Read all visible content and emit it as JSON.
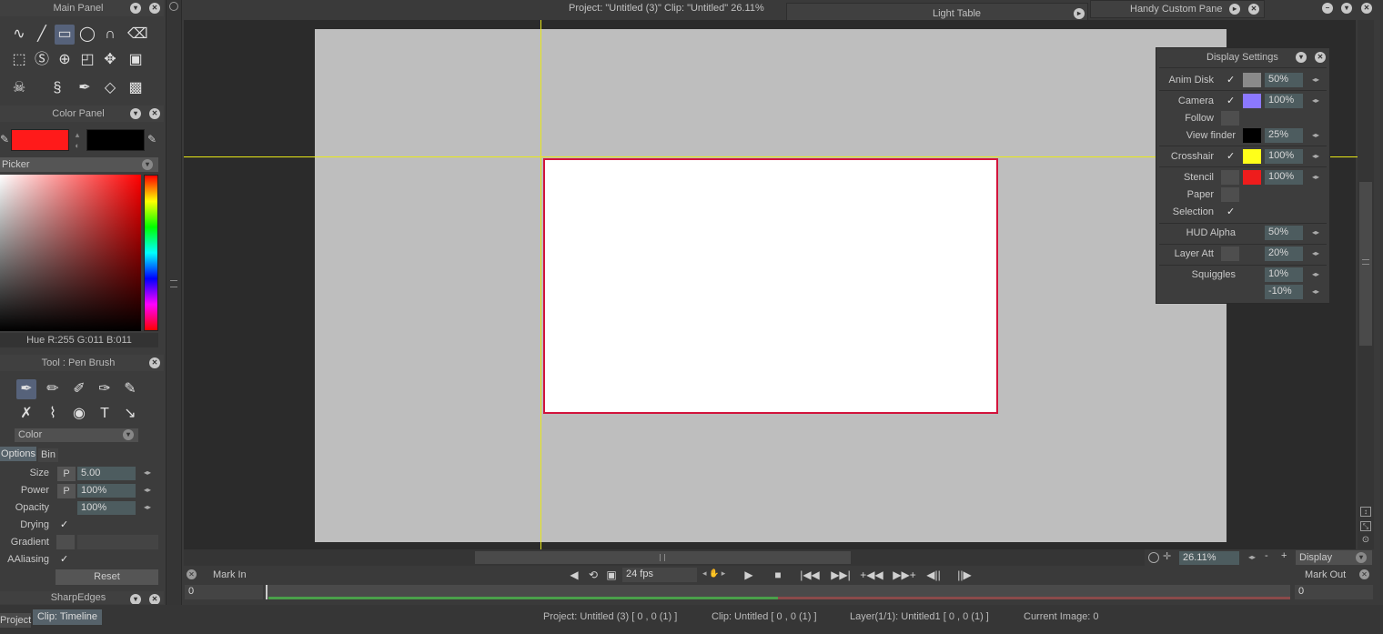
{
  "top_info": {
    "project_clip": "Project:  \"Untitled (3)\"  Clip: \"Untitled\"   26.11%",
    "light_table": "Light Table",
    "handy_custom": "Handy Custom Pane"
  },
  "main_panel": {
    "title": "Main Panel"
  },
  "color_panel": {
    "title": "Color Panel",
    "primary_color": "#ff1a1a",
    "secondary_color": "#000000",
    "picker_mode": "Picker",
    "readout": "Hue R:255 G:011 B:011"
  },
  "tool_panel": {
    "title": "Tool : Pen Brush",
    "color_dropdown": "Color",
    "tabs": [
      "Options",
      "Bin"
    ],
    "options": {
      "size_label": "Size",
      "size_value": "5.00",
      "size_p": "P",
      "power_label": "Power",
      "power_value": "100%",
      "power_p": "P",
      "opacity_label": "Opacity",
      "opacity_value": "100%",
      "drying_label": "Drying",
      "gradient_label": "Gradient",
      "aaliasing_label": "AAliasing",
      "reset_label": "Reset"
    },
    "next_panel": "SharpEdges"
  },
  "display_settings": {
    "title": "Display Settings",
    "rows": [
      {
        "label": "Anim Disk",
        "checked": true,
        "color": "#8a8a8a",
        "value": "50%"
      },
      {
        "label": "Camera",
        "checked": true,
        "color": "#8b78ff",
        "value": "100%"
      },
      {
        "label": "Follow",
        "checked": false
      },
      {
        "label": "View finder",
        "color": "#000000",
        "value": "25%"
      },
      {
        "label": "Crosshair",
        "checked": true,
        "color": "#ffff1a",
        "value": "100%"
      },
      {
        "label": "Stencil",
        "color": "#ee1c1c",
        "value": "100%"
      },
      {
        "label": "Paper"
      },
      {
        "label": "Selection",
        "checked": true
      },
      {
        "label": "HUD Alpha",
        "value": "50%"
      },
      {
        "label": "Layer Att",
        "value": "20%"
      },
      {
        "label": "Squiggles",
        "value": "10%",
        "value2": "-10%"
      }
    ]
  },
  "view_bar": {
    "zoom": "26.11%",
    "mode": "Display"
  },
  "transport": {
    "mark_in": "Mark In",
    "mark_out": "Mark Out",
    "fps": "24 fps",
    "frame_start": "0",
    "frame_end": "0"
  },
  "status_bar": {
    "tab_project": "Project",
    "tab_clip": "Clip: Timeline",
    "project": "Project: Untitled (3) [ 0 , 0  (1) ]",
    "clip": "Clip: Untitled [ 0 , 0  (1) ]",
    "layer": "Layer(1/1): Untitled1 [ 0 , 0  (1) ]",
    "current_image": "Current Image: 0"
  },
  "colors": {
    "crosshair": "#e8e818",
    "frame_border": "#d2143c",
    "canvas_bg": "#bebebe"
  }
}
